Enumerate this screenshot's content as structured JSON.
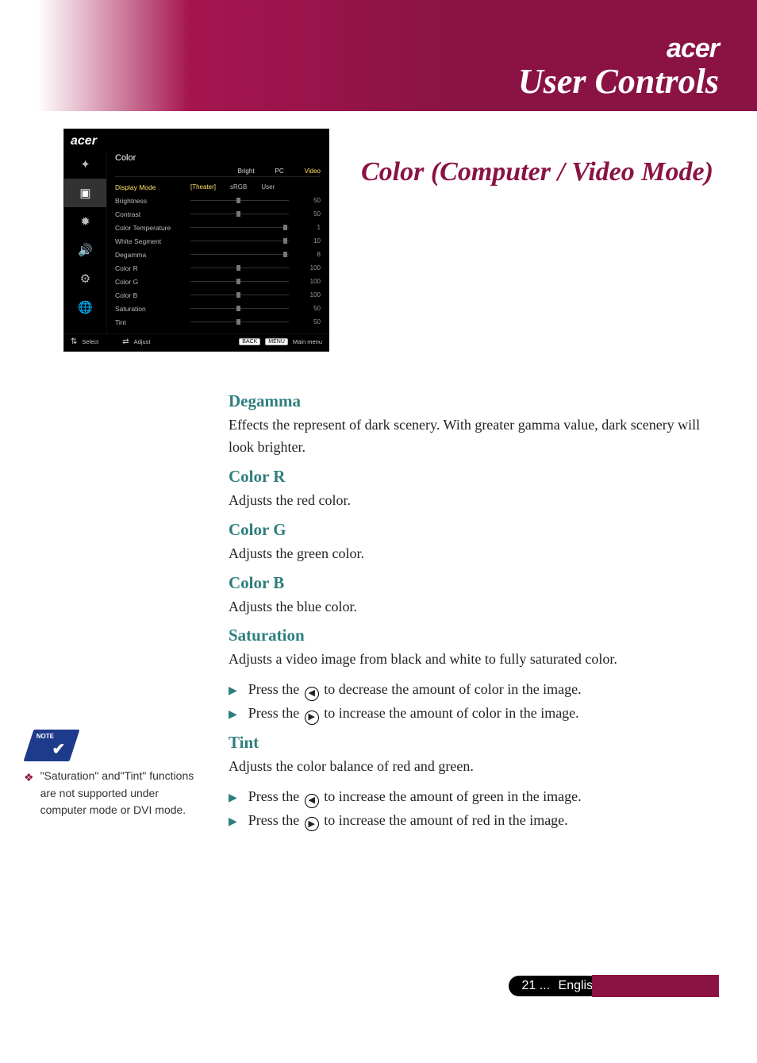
{
  "header": {
    "brand": "acer",
    "title": "User Controls"
  },
  "osd": {
    "brand": "acer",
    "panel_title": "Color",
    "source_tabs": [
      "Bright",
      "PC",
      "Video"
    ],
    "source_active": "Video",
    "icons": [
      "compass",
      "image",
      "color-wheel",
      "audio",
      "management",
      "language"
    ],
    "mode_row": {
      "label": "Display Mode",
      "options": [
        "[Theater]",
        "sRGB",
        "User"
      ]
    },
    "sliders": [
      {
        "label": "Brightness",
        "value": 50,
        "pct": 50
      },
      {
        "label": "Contrast",
        "value": 50,
        "pct": 50
      },
      {
        "label": "Color Temperature",
        "value": 1,
        "pct": 92
      },
      {
        "label": "White Segment",
        "value": 10,
        "pct": 92
      },
      {
        "label": "Degamma",
        "value": 8,
        "pct": 92
      },
      {
        "label": "Color R",
        "value": 100,
        "pct": 50
      },
      {
        "label": "Color G",
        "value": 100,
        "pct": 50
      },
      {
        "label": "Color B",
        "value": 100,
        "pct": 50
      },
      {
        "label": "Saturation",
        "value": 50,
        "pct": 50
      },
      {
        "label": "Tint",
        "value": 50,
        "pct": 50
      }
    ],
    "footer": {
      "select": "Select",
      "adjust": "Adjust",
      "back": "BACK",
      "menu": "MENU",
      "mainmenu": "Main menu"
    }
  },
  "section_title": "Color (Computer / Video Mode)",
  "body": {
    "degamma": {
      "h": "Degamma",
      "p": "Effects the represent of dark scenery. With greater gamma value, dark scenery will look brighter."
    },
    "colorR": {
      "h": "Color R",
      "p": "Adjusts the red color."
    },
    "colorG": {
      "h": "Color G",
      "p": "Adjusts the green color."
    },
    "colorB": {
      "h": "Color B",
      "p": "Adjusts the blue color."
    },
    "saturation": {
      "h": "Saturation",
      "p": "Adjusts a video image from black and white to fully saturated color.",
      "b1a": "Press the ",
      "b1b": " to decrease the amount of color in the image.",
      "b2a": "Press the ",
      "b2b": " to increase the amount of color in the image."
    },
    "tint": {
      "h": "Tint",
      "p": "Adjusts the color balance of red and green.",
      "b1a": "Press the ",
      "b1b": " to increase the amount of green in the image.",
      "b2a": "Press the ",
      "b2b": " to increase the amount of red in the image."
    }
  },
  "note": {
    "label": "NOTE",
    "text": "\"Saturation\" and\"Tint\" functions are not supported under computer mode or DVI mode."
  },
  "footer": {
    "page": "21",
    "dots": "...",
    "lang": "English"
  }
}
